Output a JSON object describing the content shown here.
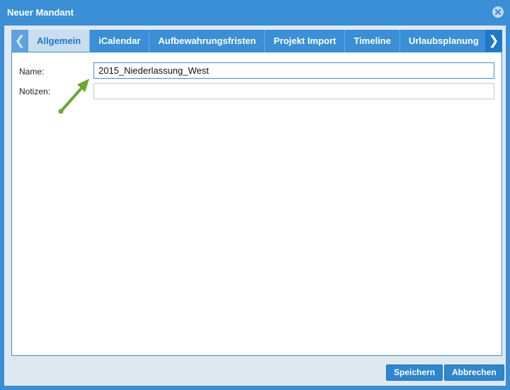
{
  "window": {
    "title": "Neuer Mandant"
  },
  "tabs": [
    {
      "label": "Allgemein",
      "active": true
    },
    {
      "label": "iCalendar",
      "active": false
    },
    {
      "label": "Aufbewahrungsfristen",
      "active": false
    },
    {
      "label": "Projekt Import",
      "active": false
    },
    {
      "label": "Timeline",
      "active": false
    },
    {
      "label": "Urlaubsplanung",
      "active": false
    }
  ],
  "nav": {
    "left_glyph": "❮",
    "right_glyph": "❯"
  },
  "form": {
    "name_label": "Name:",
    "name_value": "2015_Niederlassung_West",
    "notes_label": "Notizen:",
    "notes_value": ""
  },
  "footer": {
    "save_label": "Speichern",
    "cancel_label": "Abbrechen"
  },
  "colors": {
    "accent": "#3a8fd6",
    "arrow": "#6aa832"
  }
}
